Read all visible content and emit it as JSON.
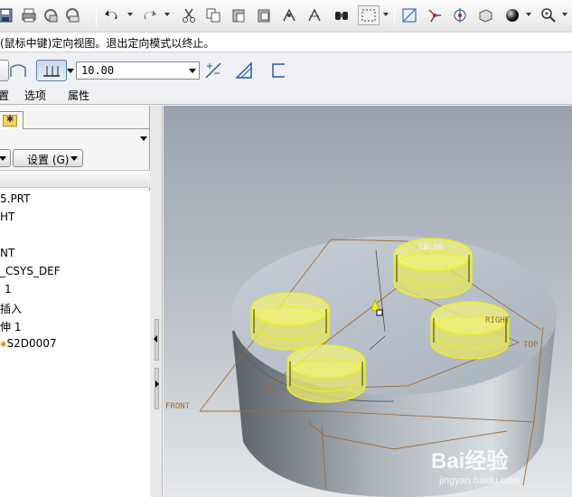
{
  "toolbar": {
    "icons": [
      "save-icon",
      "print-icon",
      "send-icon",
      "copy-window-icon",
      "undo-icon",
      "redo-icon",
      "cut-icon",
      "copy-icon",
      "paste-icon",
      "paste-special-icon",
      "regenerate-icon",
      "regenerate-manager-icon",
      "find-icon",
      "select-box-icon",
      "datum-display-icon",
      "datum-axes-icon",
      "spin-center-icon",
      "orient-icon",
      "shading-icon",
      "zoom-in-icon"
    ]
  },
  "message": {
    "text": "(鼠标中键)定向视图。退出定向模式以终止。"
  },
  "dashboard": {
    "depth_value": "10.00",
    "icons": [
      "extrude-solid-icon",
      "extrude-surface-icon",
      "blind-depth-icon",
      "flip-direction-icon",
      "remove-material-icon",
      "thicken-icon"
    ]
  },
  "tabs": {
    "placement": "置",
    "options": "选项",
    "properties": "属性"
  },
  "left_panel": {
    "settings_label": "设置 (G)",
    "tree_items": [
      "5.PRT",
      "HT",
      "",
      "NT",
      "_CSYS_DEF",
      "1",
      "插入",
      "伸 1",
      "S2D0007"
    ]
  },
  "viewport": {
    "dimension_label": "10.00",
    "datum_labels": {
      "right": "RIGHT",
      "top": "TOP",
      "front": "FRONT"
    },
    "colors": {
      "part": "#b8c2cc",
      "feature": "#f2f27a",
      "feature_edge": "#f0ef1a",
      "datum": "#a06a36"
    }
  },
  "watermark": {
    "brand": "Bai经验",
    "url": "jingyan.baidu.com"
  }
}
